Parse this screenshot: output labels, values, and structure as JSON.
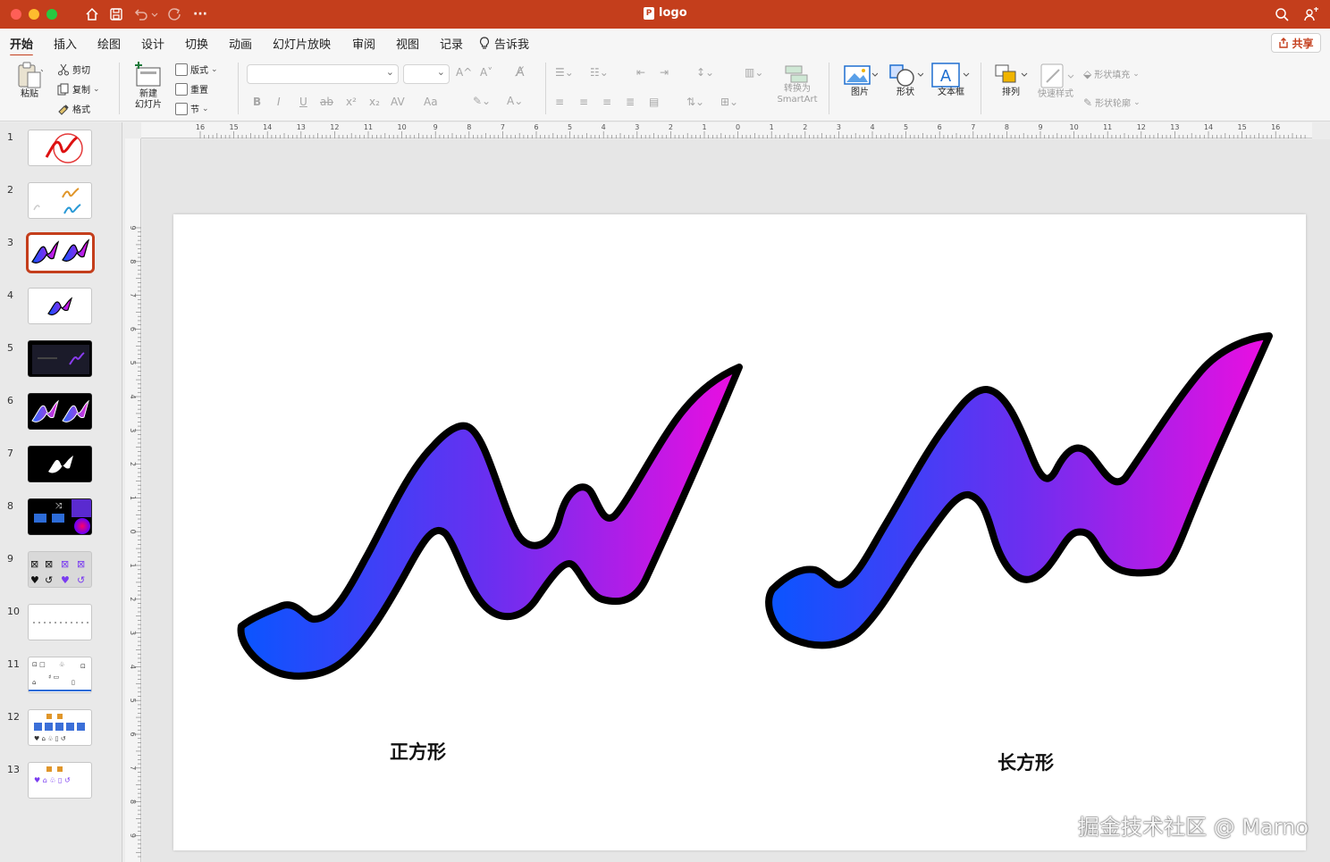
{
  "window": {
    "title": "logo"
  },
  "menu": {
    "tabs": [
      "开始",
      "插入",
      "绘图",
      "设计",
      "切换",
      "动画",
      "幻灯片放映",
      "审阅",
      "视图",
      "记录"
    ],
    "tell_me": "告诉我",
    "share": "共享"
  },
  "ribbon": {
    "paste": "粘贴",
    "cut": "剪切",
    "copy": "复制",
    "format": "格式",
    "new_slide_line1": "新建",
    "new_slide_line2": "幻灯片",
    "layout": "版式",
    "reset": "重置",
    "section": "节",
    "bold": "B",
    "italic": "I",
    "underline": "U",
    "strikethrough": "ab",
    "superscript": "x²",
    "subscript": "x₂",
    "char_spacing": "AV",
    "change_case": "Aa",
    "grow_font": "A^",
    "shrink_font": "A˅",
    "convert_smartart_line1": "转换为",
    "convert_smartart_line2": "SmartArt",
    "picture": "图片",
    "shape": "形状",
    "textbox": "文本框",
    "arrange": "排列",
    "quick_styles": "快速样式",
    "shape_fill": "形状填充",
    "shape_outline": "形状轮廓"
  },
  "slides": {
    "count": 13,
    "numbers": [
      "1",
      "2",
      "3",
      "4",
      "5",
      "6",
      "7",
      "8",
      "9",
      "10",
      "11",
      "12",
      "13"
    ],
    "selected": 3
  },
  "ruler": {
    "horizontal_labels": [
      "16",
      "15",
      "14",
      "13",
      "12",
      "11",
      "10",
      "9",
      "8",
      "7",
      "6",
      "5",
      "4",
      "3",
      "2",
      "1",
      "0",
      "1",
      "2",
      "3",
      "4",
      "5",
      "6",
      "7",
      "8",
      "9",
      "10",
      "11",
      "12",
      "13",
      "14",
      "15",
      "16"
    ],
    "vertical_labels": [
      "9",
      "8",
      "7",
      "6",
      "5",
      "4",
      "3",
      "2",
      "1",
      "0",
      "1",
      "2",
      "3",
      "4",
      "5",
      "6",
      "7",
      "8",
      "9"
    ]
  },
  "slide": {
    "label_left": "正方形",
    "label_right": "长方形",
    "watermark": "掘金技术社区 @ Marno"
  },
  "colors": {
    "accent": "#c43e1c",
    "gradient_start": "#0a55ff",
    "gradient_mid": "#6a2ff0",
    "gradient_end": "#ec0ee0",
    "outline": "#000000"
  }
}
